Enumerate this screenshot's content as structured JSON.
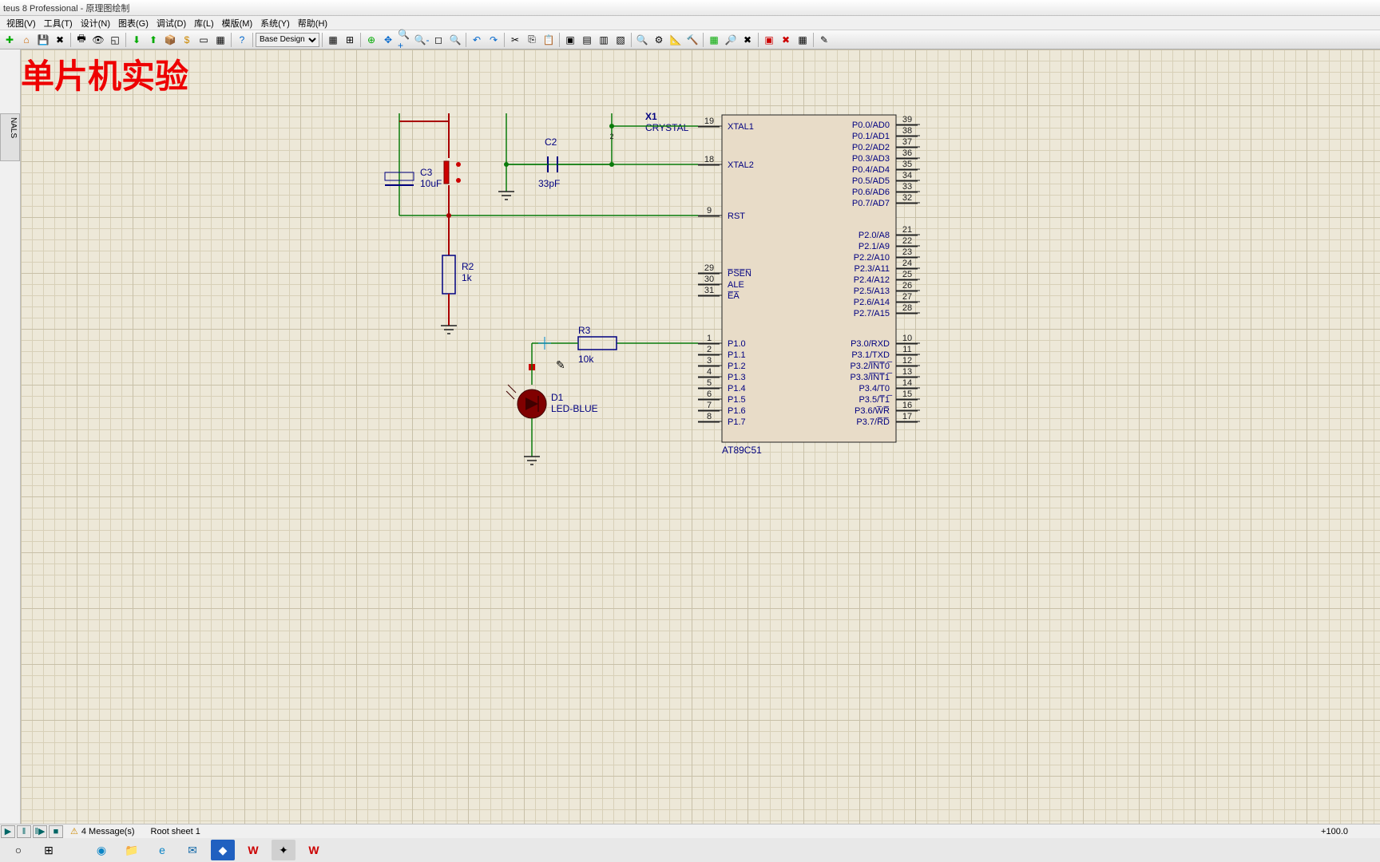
{
  "title": "teus 8 Professional - 原理图绘制",
  "menus": [
    "视图(V)",
    "工具(T)",
    "设计(N)",
    "图表(G)",
    "调试(D)",
    "库(L)",
    "模版(M)",
    "系统(Y)",
    "帮助(H)"
  ],
  "design_mode": "Base Design",
  "watermark": "单片机实验",
  "sidepanel_label": "NALS",
  "status": {
    "messages": "4 Message(s)",
    "sheet": "Root sheet 1",
    "coord": "+100.0"
  },
  "chip": {
    "name": "AT89C51",
    "left_pins": [
      {
        "num": "19",
        "lbl": "XTAL1"
      },
      {
        "num": "18",
        "lbl": "XTAL2"
      },
      {
        "num": "9",
        "lbl": "RST"
      },
      {
        "num": "29",
        "lbl": "P̅S̅E̅N̅"
      },
      {
        "num": "30",
        "lbl": "ALE"
      },
      {
        "num": "31",
        "lbl": "E̅A̅"
      },
      {
        "num": "1",
        "lbl": "P1.0"
      },
      {
        "num": "2",
        "lbl": "P1.1"
      },
      {
        "num": "3",
        "lbl": "P1.2"
      },
      {
        "num": "4",
        "lbl": "P1.3"
      },
      {
        "num": "5",
        "lbl": "P1.4"
      },
      {
        "num": "6",
        "lbl": "P1.5"
      },
      {
        "num": "7",
        "lbl": "P1.6"
      },
      {
        "num": "8",
        "lbl": "P1.7"
      }
    ],
    "right_pins": [
      {
        "num": "39",
        "lbl": "P0.0/AD0"
      },
      {
        "num": "38",
        "lbl": "P0.1/AD1"
      },
      {
        "num": "37",
        "lbl": "P0.2/AD2"
      },
      {
        "num": "36",
        "lbl": "P0.3/AD3"
      },
      {
        "num": "35",
        "lbl": "P0.4/AD4"
      },
      {
        "num": "34",
        "lbl": "P0.5/AD5"
      },
      {
        "num": "33",
        "lbl": "P0.6/AD6"
      },
      {
        "num": "32",
        "lbl": "P0.7/AD7"
      },
      {
        "num": "21",
        "lbl": "P2.0/A8"
      },
      {
        "num": "22",
        "lbl": "P2.1/A9"
      },
      {
        "num": "23",
        "lbl": "P2.2/A10"
      },
      {
        "num": "24",
        "lbl": "P2.3/A11"
      },
      {
        "num": "25",
        "lbl": "P2.4/A12"
      },
      {
        "num": "26",
        "lbl": "P2.5/A13"
      },
      {
        "num": "27",
        "lbl": "P2.6/A14"
      },
      {
        "num": "28",
        "lbl": "P2.7/A15"
      },
      {
        "num": "10",
        "lbl": "P3.0/RXD"
      },
      {
        "num": "11",
        "lbl": "P3.1/TXD"
      },
      {
        "num": "12",
        "lbl": "P3.2/I̅N̅T̅0̅"
      },
      {
        "num": "13",
        "lbl": "P3.3/I̅N̅T̅1̅"
      },
      {
        "num": "14",
        "lbl": "P3.4/T0"
      },
      {
        "num": "15",
        "lbl": "P3.5/T̅1̅"
      },
      {
        "num": "16",
        "lbl": "P3.6/W̅R̅"
      },
      {
        "num": "17",
        "lbl": "P3.7/R̅D̅"
      }
    ]
  },
  "components": {
    "crystal": {
      "ref": "X1",
      "val": "CRYSTAL"
    },
    "c2": {
      "ref": "C2",
      "val": "33pF"
    },
    "c3": {
      "ref": "C3",
      "val": "10uF"
    },
    "r2": {
      "ref": "R2",
      "val": "1k"
    },
    "r3": {
      "ref": "R3",
      "val": "10k"
    },
    "d1": {
      "ref": "D1",
      "val": "LED-BLUE"
    }
  }
}
